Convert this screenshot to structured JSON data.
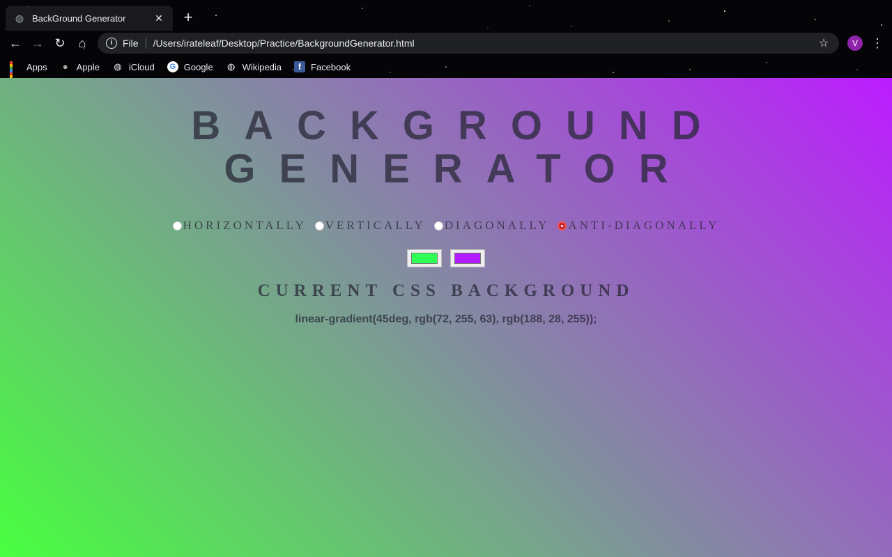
{
  "browser": {
    "tab_title": "BackGround Generator",
    "omnibox": {
      "scheme": "File",
      "url": "/Users/irateleaf/Desktop/Practice/BackgroundGenerator.html"
    },
    "profile_initial": "V",
    "bookmarks": [
      {
        "label": "Apps",
        "icon": "apps-grid-icon"
      },
      {
        "label": "Apple",
        "icon": "apple-icon"
      },
      {
        "label": "iCloud",
        "icon": "globe-icon"
      },
      {
        "label": "Google",
        "icon": "google-icon"
      },
      {
        "label": "Wikipedia",
        "icon": "globe-icon"
      },
      {
        "label": "Facebook",
        "icon": "facebook-icon"
      }
    ]
  },
  "page": {
    "heading_line1": "BACKGROUND",
    "heading_line2": "GENERATOR",
    "radios": [
      {
        "label": "HORIZONTALLY",
        "checked": false
      },
      {
        "label": "VERTICALLY",
        "checked": false
      },
      {
        "label": "DIAGONALLY",
        "checked": false
      },
      {
        "label": "ANTI-DIAGONALLY",
        "checked": true
      }
    ],
    "color1": "#30ff54",
    "color2": "#b21cff",
    "subheading": "CURRENT CSS BACKGROUND",
    "css_output": "linear-gradient(45deg, rgb(72, 255, 63), rgb(188, 28, 255));"
  }
}
